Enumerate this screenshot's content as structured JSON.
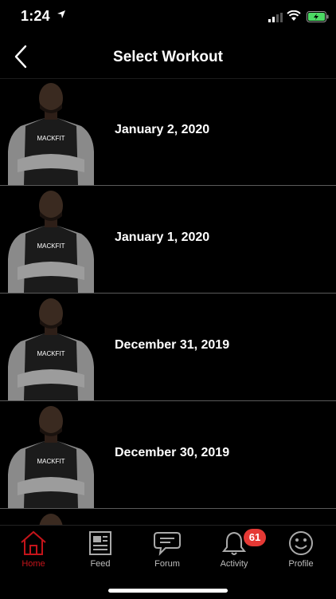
{
  "status": {
    "time": "1:24"
  },
  "header": {
    "title": "Select Workout",
    "back_icon": "chevron-left-icon"
  },
  "workouts": [
    {
      "label": "January 2, 2020"
    },
    {
      "label": "January 1, 2020"
    },
    {
      "label": "December 31, 2019"
    },
    {
      "label": "December 30, 2019"
    }
  ],
  "shirt_text": "MACKFIT",
  "tabs": [
    {
      "label": "Home",
      "icon": "home-icon"
    },
    {
      "label": "Feed",
      "icon": "newspaper-icon"
    },
    {
      "label": "Forum",
      "icon": "chat-bubble-icon"
    },
    {
      "label": "Activity",
      "icon": "bell-icon"
    },
    {
      "label": "Profile",
      "icon": "smiley-icon"
    }
  ],
  "activity_badge": "61",
  "colors": {
    "accent": "#c4141a",
    "badge": "#e53935",
    "battery": "#4cd964"
  }
}
